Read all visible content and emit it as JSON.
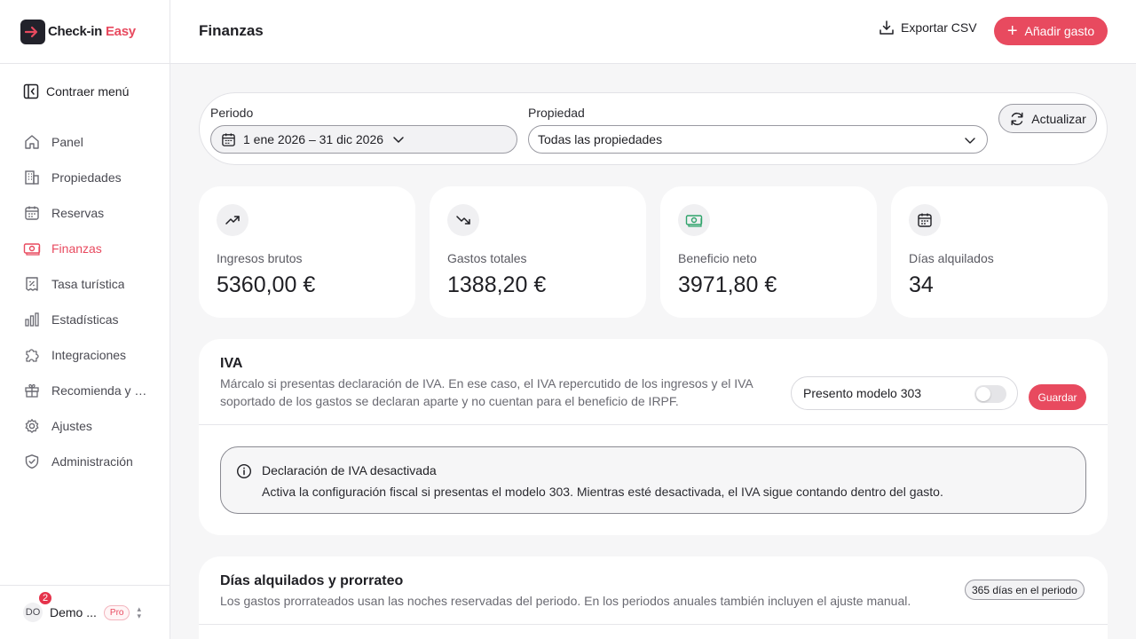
{
  "app": {
    "name_main": "Check-in",
    "name_accent": "Easy"
  },
  "sidebar": {
    "collapse_label": "Contraer menú",
    "items": [
      {
        "label": "Panel",
        "icon": "home-icon"
      },
      {
        "label": "Propiedades",
        "icon": "building-icon"
      },
      {
        "label": "Reservas",
        "icon": "calendar-icon"
      },
      {
        "label": "Finanzas",
        "icon": "money-icon",
        "active": true
      },
      {
        "label": "Tasa turística",
        "icon": "receipt-icon"
      },
      {
        "label": "Estadísticas",
        "icon": "bar-chart-icon"
      },
      {
        "label": "Integraciones",
        "icon": "puzzle-icon"
      },
      {
        "label": "Recomienda y gana",
        "icon": "gift-icon"
      },
      {
        "label": "Ajustes",
        "icon": "gear-icon"
      },
      {
        "label": "Administración",
        "icon": "shield-icon"
      }
    ],
    "user": {
      "initials": "DO",
      "name": "Demo ...",
      "badge": "Pro",
      "notifications": "2"
    }
  },
  "header": {
    "title": "Finanzas",
    "export_label": "Exportar CSV",
    "add_label": "Añadir gasto"
  },
  "filters": {
    "period_label": "Periodo",
    "period_value": "1 ene 2026 – 31 dic 2026",
    "property_label": "Propiedad",
    "property_value": "Todas las propiedades",
    "refresh_label": "Actualizar"
  },
  "kpis": [
    {
      "label": "Ingresos brutos",
      "value": "5360,00 €",
      "icon": "trending-up-icon"
    },
    {
      "label": "Gastos totales",
      "value": "1388,20 €",
      "icon": "trending-down-icon"
    },
    {
      "label": "Beneficio neto",
      "value": "3971,80 €",
      "icon": "banknote-icon"
    },
    {
      "label": "Días alquilados",
      "value": "34",
      "icon": "calendar-icon"
    }
  ],
  "iva": {
    "title": "IVA",
    "description": "Márcalo si presentas declaración de IVA. En ese caso, el IVA repercutido de los ingresos y el IVA soportado de los gastos se declaran aparte y no cuentan para el beneficio de IRPF.",
    "toggle_label": "Presento modelo 303",
    "toggle_on": false,
    "save_label": "Guardar",
    "alert_title": "Declaración de IVA desactivada",
    "alert_text": "Activa la configuración fiscal si presentas el modelo 303. Mientras esté desactivada, el IVA sigue contando dentro del gasto."
  },
  "days": {
    "title": "Días alquilados y prorrateo",
    "description": "Los gastos prorrateados usan las noches reservadas del periodo. En los periodos anuales también incluyen el ajuste manual.",
    "badge": "365 días en el periodo"
  },
  "colors": {
    "accent": "#e84a5f",
    "dark": "#22222b",
    "money_green": "#2fa36b"
  }
}
